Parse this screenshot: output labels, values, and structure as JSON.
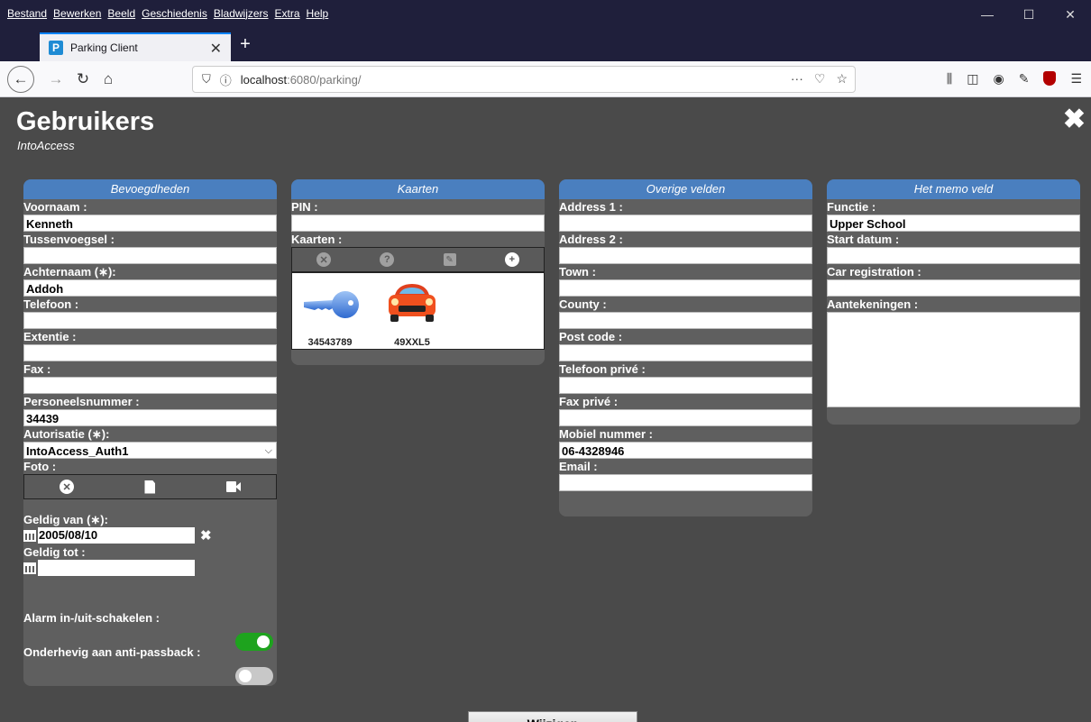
{
  "browser": {
    "menu": [
      "Bestand",
      "Bewerken",
      "Beeld",
      "Geschiedenis",
      "Bladwijzers",
      "Extra",
      "Help"
    ],
    "tab_title": "Parking Client",
    "favicon_letter": "P",
    "url_host": "localhost",
    "url_rest": ":6080/parking/"
  },
  "page": {
    "title": "Gebruikers",
    "subtitle": "IntoAccess"
  },
  "panel1": {
    "header": "Bevoegdheden",
    "voornaam_label": "Voornaam :",
    "voornaam": "Kenneth",
    "tussenvoegsel_label": "Tussenvoegsel :",
    "tussenvoegsel": "",
    "achternaam_label": "Achternaam (∗):",
    "achternaam": "Addoh",
    "telefoon_label": "Telefoon :",
    "telefoon": "",
    "extentie_label": "Extentie :",
    "extentie": "",
    "fax_label": "Fax :",
    "fax": "",
    "personeelsnummer_label": "Personeelsnummer :",
    "personeelsnummer": "34439",
    "autorisatie_label": "Autorisatie (∗):",
    "autorisatie": "IntoAccess_Auth1",
    "foto_label": "Foto :",
    "geldig_van_label": "Geldig van (∗):",
    "geldig_van": "2005/08/10",
    "geldig_tot_label": "Geldig tot :",
    "geldig_tot": "",
    "alarm_label": "Alarm in-/uit-schakelen :",
    "alarm_on": true,
    "antipassback_label": "Onderhevig aan anti-passback :",
    "antipassback_on": false
  },
  "panel2": {
    "header": "Kaarten",
    "pin_label": "PIN :",
    "pin": "",
    "kaarten_label": "Kaarten :",
    "cards": [
      {
        "type": "key-icon",
        "number": "34543789"
      },
      {
        "type": "car-icon",
        "number": "49XXL5"
      }
    ]
  },
  "panel3": {
    "header": "Overige velden",
    "fields": [
      {
        "label": "Address 1 :",
        "value": ""
      },
      {
        "label": "Address 2 :",
        "value": ""
      },
      {
        "label": "Town :",
        "value": ""
      },
      {
        "label": "County :",
        "value": ""
      },
      {
        "label": "Post code :",
        "value": ""
      },
      {
        "label": "Telefoon privé :",
        "value": ""
      },
      {
        "label": "Fax privé :",
        "value": ""
      },
      {
        "label": "Mobiel nummer :",
        "value": "06-4328946"
      },
      {
        "label": "Email :",
        "value": ""
      }
    ]
  },
  "panel4": {
    "header": "Het memo veld",
    "functie_label": "Functie :",
    "functie": "Upper School",
    "start_label": "Start datum :",
    "start": "",
    "car_label": "Car registration :",
    "car": "",
    "notes_label": "Aantekeningen :",
    "notes": ""
  },
  "actions": {
    "save_label": "Wijzigen"
  },
  "colors": {
    "header_blue": "#4a7fbf",
    "toggle_on": "#1ea31e",
    "page_bg": "#4a4a4a"
  }
}
